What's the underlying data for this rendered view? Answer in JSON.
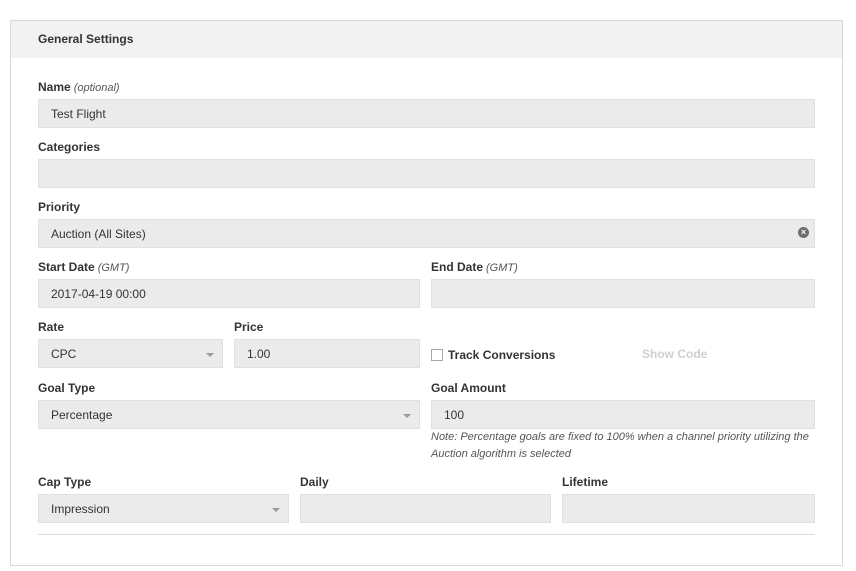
{
  "panel": {
    "title": "General Settings"
  },
  "name": {
    "label": "Name",
    "hint": "(optional)",
    "value": "Test Flight"
  },
  "categories": {
    "label": "Categories",
    "value": ""
  },
  "priority": {
    "label": "Priority",
    "value": "Auction (All Sites)"
  },
  "start_date": {
    "label": "Start Date",
    "hint": "(GMT)",
    "value": "2017-04-19 00:00"
  },
  "end_date": {
    "label": "End Date",
    "hint": "(GMT)",
    "value": ""
  },
  "rate": {
    "label": "Rate",
    "value": "CPC"
  },
  "price": {
    "label": "Price",
    "value": "1.00"
  },
  "track_conversions": {
    "label": "Track Conversions",
    "checked": false
  },
  "show_code": {
    "label": "Show Code"
  },
  "goal_type": {
    "label": "Goal Type",
    "value": "Percentage"
  },
  "goal_amount": {
    "label": "Goal Amount",
    "value": "100",
    "note": "Note: Percentage goals are fixed to 100% when a channel priority utilizing the Auction algorithm is selected"
  },
  "cap_type": {
    "label": "Cap Type",
    "value": "Impression"
  },
  "daily": {
    "label": "Daily",
    "value": ""
  },
  "lifetime": {
    "label": "Lifetime",
    "value": ""
  },
  "icons": {
    "clear": "clear-circle-icon",
    "dropdown": "chevron-down-icon"
  }
}
